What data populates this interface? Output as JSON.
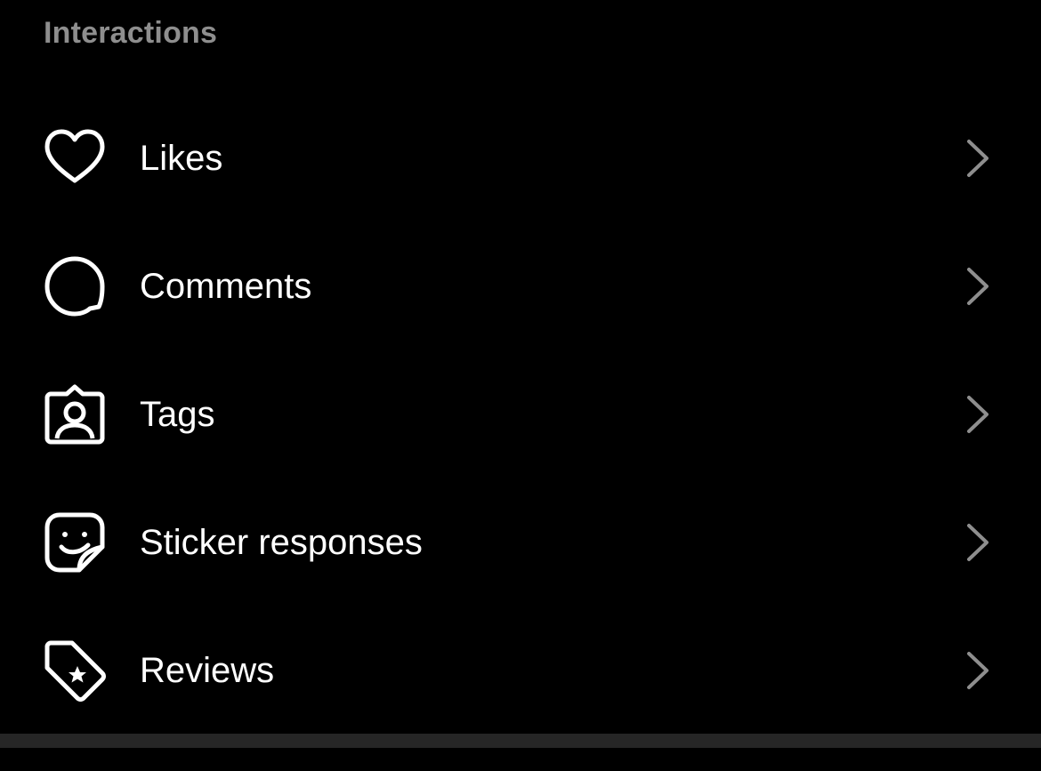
{
  "section": {
    "title": "Interactions"
  },
  "menu": {
    "items": [
      {
        "label": "Likes",
        "icon": "heart-icon"
      },
      {
        "label": "Comments",
        "icon": "speech-bubble-icon"
      },
      {
        "label": "Tags",
        "icon": "person-tag-icon"
      },
      {
        "label": "Sticker responses",
        "icon": "sticker-icon"
      },
      {
        "label": "Reviews",
        "icon": "star-tag-icon"
      }
    ]
  },
  "colors": {
    "background": "#000000",
    "text": "#ffffff",
    "header_text": "#8e8e8e",
    "chevron": "#8e8e8e",
    "divider": "#262626"
  }
}
